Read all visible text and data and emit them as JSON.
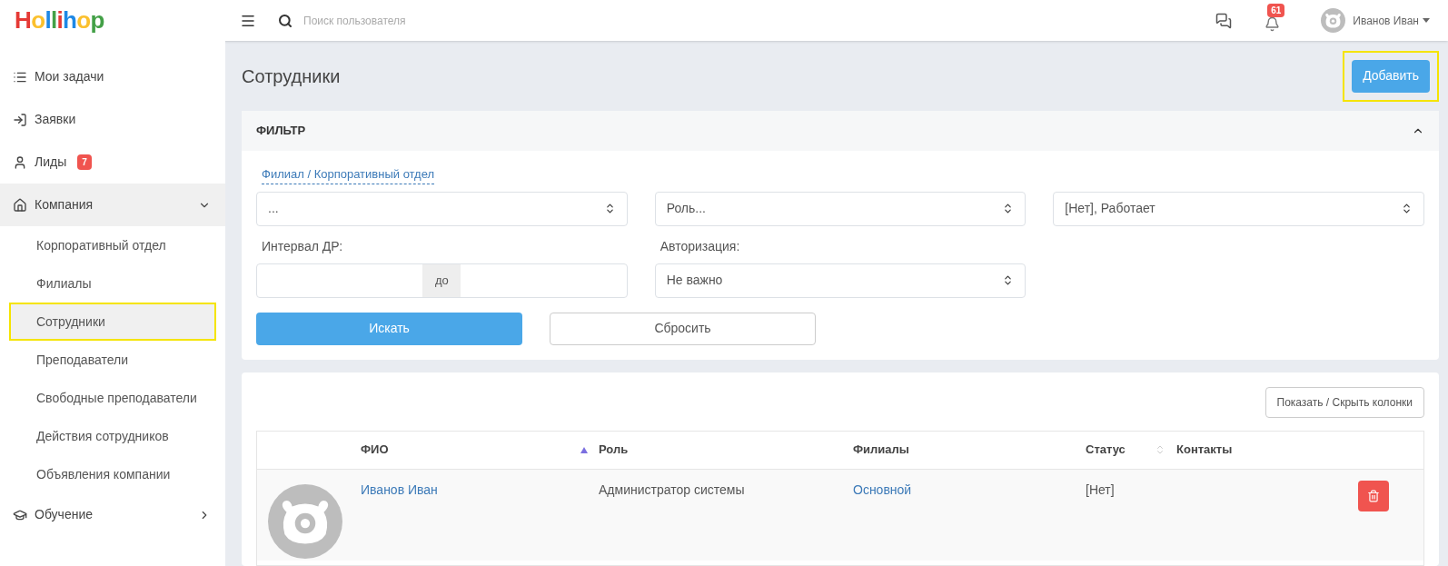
{
  "header": {
    "logo": "Hollihop",
    "search": {
      "placeholder": "Поиск пользователя"
    },
    "notifications": "61",
    "user": "Иванов Иван"
  },
  "sidebar": {
    "items": [
      {
        "label": "Мои задачи",
        "selected": false
      },
      {
        "label": "Заявки",
        "selected": false
      },
      {
        "label": "Лиды",
        "badge": "7",
        "selected": false
      },
      {
        "label": "Компания",
        "selected": true,
        "expanded": true,
        "children": [
          {
            "label": "Корпоративный отдел",
            "selected": false,
            "highlighted": false
          },
          {
            "label": "Филиалы",
            "selected": false,
            "highlighted": false
          },
          {
            "label": "Сотрудники",
            "selected": true,
            "highlighted": true
          },
          {
            "label": "Преподаватели",
            "selected": false,
            "highlighted": false
          },
          {
            "label": "Свободные преподаватели",
            "selected": false,
            "highlighted": false
          },
          {
            "label": "Действия сотрудников",
            "selected": false,
            "highlighted": false
          },
          {
            "label": "Объявления компании",
            "selected": false,
            "highlighted": false
          }
        ]
      },
      {
        "label": "Обучение",
        "selected": false,
        "expanded": false
      }
    ]
  },
  "page": {
    "title": "Сотрудники",
    "add_button": {
      "label": "Добавить",
      "highlighted": true
    }
  },
  "filter": {
    "title": "ФИЛЬТР",
    "expanded": true,
    "branch_link": "Филиал / Корпоративный отдел",
    "selects": [
      {
        "value": "..."
      },
      {
        "value": "Роль..."
      },
      {
        "value": "[Нет], Работает"
      }
    ],
    "birthday_label": "Интервал ДР:",
    "birthday_separator": "до",
    "auth_label": "Авторизация:",
    "auth_select": {
      "value": "Не важно"
    },
    "search_button": "Искать",
    "reset_button": "Сбросить"
  },
  "table": {
    "columns_button": "Показать / Скрыть колонки",
    "columns": [
      {
        "label": "ФИО",
        "sorted": true,
        "sortable": false
      },
      {
        "label": "Роль",
        "sorted": false,
        "sortable": false
      },
      {
        "label": "Филиалы",
        "sorted": false,
        "sortable": false
      },
      {
        "label": "Статус",
        "sorted": false,
        "sortable": true
      },
      {
        "label": "Контакты",
        "sorted": false,
        "sortable": false
      }
    ],
    "rows": [
      {
        "name": "Иванов Иван",
        "role": "Администратор системы",
        "branch": "Основной",
        "status": "[Нет]"
      }
    ]
  }
}
